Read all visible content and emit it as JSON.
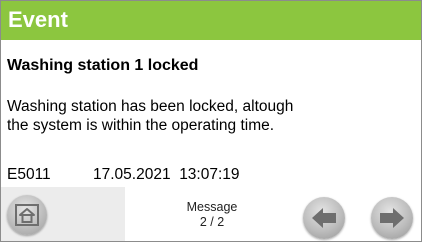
{
  "header": {
    "title": "Event"
  },
  "event": {
    "heading": "Washing station 1 locked",
    "description_line1": "Washing station has been locked, altough",
    "description_line2": "the system is within the operating time.",
    "code": "E5011",
    "timestamp": "17.05.2021  13:07:19"
  },
  "footer": {
    "message_label": "Message",
    "message_count": "2 / 2",
    "home_icon": "home-icon",
    "prev_icon": "arrow-left-icon",
    "next_icon": "arrow-right-icon"
  },
  "colors": {
    "accent": "#8cc63f",
    "title_text": "#ffffff",
    "button": "#bdbdbd",
    "icon_dark": "#6e6e6e"
  }
}
